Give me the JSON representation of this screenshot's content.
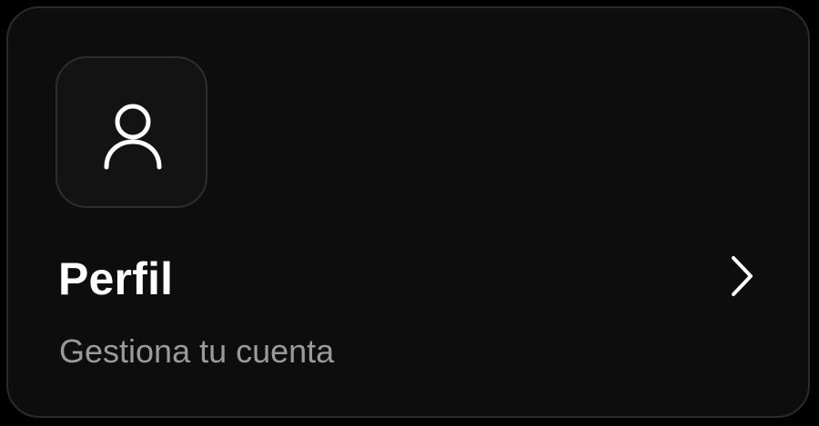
{
  "card": {
    "icon": "user-icon",
    "title": "Perfil",
    "subtitle": "Gestiona tu cuenta",
    "trailing_icon": "chevron-right-icon"
  },
  "colors": {
    "background": "#000000",
    "card_background": "#0d0d0d",
    "card_border": "#2b2b2b",
    "title": "#ffffff",
    "subtitle": "#9a9a9a",
    "icon": "#ffffff"
  }
}
